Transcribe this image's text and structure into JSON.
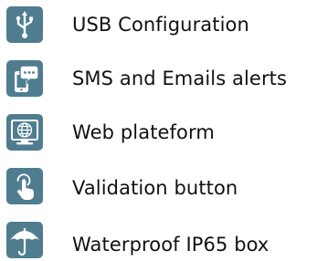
{
  "features": [
    {
      "icon": "usb-icon",
      "label": "USB Configuration"
    },
    {
      "icon": "sms-email-phone-icon",
      "label": "SMS and Emails alerts"
    },
    {
      "icon": "web-globe-monitor-icon",
      "label": "Web plateform"
    },
    {
      "icon": "pointer-hand-icon",
      "label": "Validation button"
    },
    {
      "icon": "umbrella-icon",
      "label": "Waterproof IP65 box"
    }
  ],
  "colors": {
    "tile": "#4f7d8f",
    "glyph": "#ffffff",
    "text": "#111111"
  }
}
